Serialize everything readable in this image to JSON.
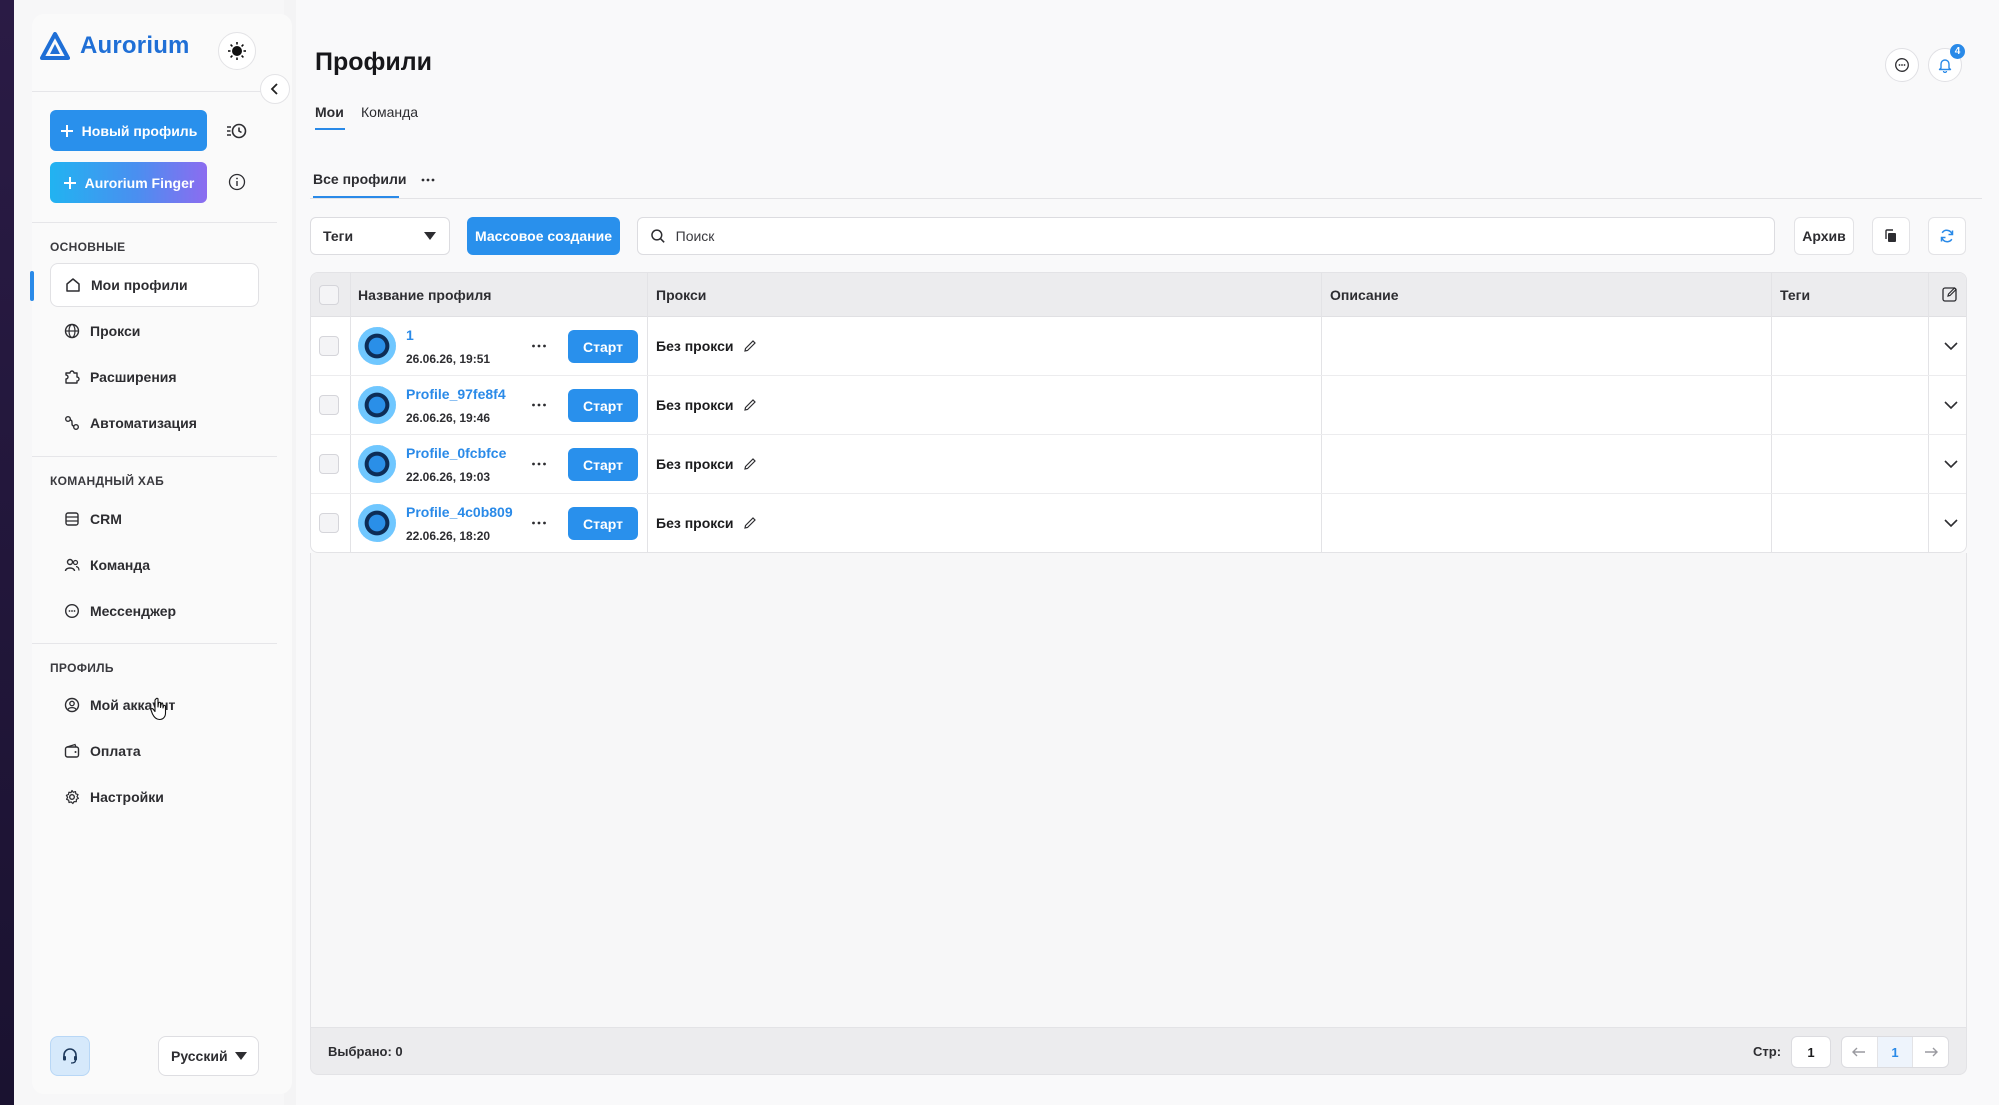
{
  "app": {
    "name": "Aurorium",
    "brand_color": "#1f6fd6",
    "accent_color": "#2990ec"
  },
  "sidebar": {
    "new_profile_label": "Новый профиль",
    "finger_label": "Aurorium Finger",
    "sections": {
      "main": "ОСНОВНЫЕ",
      "team": "КОМАНДНЫЙ ХАБ",
      "profile": "ПРОФИЛЬ"
    },
    "items": {
      "my_profiles": "Мои профили",
      "proxies": "Прокси",
      "extensions": "Расширения",
      "automation": "Автоматизация",
      "crm": "CRM",
      "team": "Команда",
      "messenger": "Мессенджер",
      "my_account": "Мой аккаунт",
      "payment": "Оплата",
      "settings": "Настройки"
    },
    "language": "Русский"
  },
  "header": {
    "title": "Профили",
    "notifications_count": "4",
    "tabs": [
      "Мои",
      "Команда"
    ],
    "subtab": "Все профили"
  },
  "toolbar": {
    "tags_label": "Теги",
    "mass_create_label": "Массовое создание",
    "search_placeholder": "Поиск",
    "archive_label": "Архив"
  },
  "table": {
    "columns": [
      "Название профиля",
      "Прокси",
      "Описание",
      "Теги"
    ],
    "start_label": "Старт",
    "rows": [
      {
        "name": "1",
        "date": "26.06.26, 19:51",
        "proxy": "Без прокси"
      },
      {
        "name": "Profile_97fe8f4",
        "date": "26.06.26, 19:46",
        "proxy": "Без прокси"
      },
      {
        "name": "Profile_0fcbfce",
        "date": "22.06.26, 19:03",
        "proxy": "Без прокси"
      },
      {
        "name": "Profile_4c0b809",
        "date": "22.06.26, 18:20",
        "proxy": "Без прокси"
      }
    ]
  },
  "footer": {
    "selected": "Выбрано: 0",
    "page_label": "Стр:",
    "page_input": "1",
    "current_page": "1"
  }
}
